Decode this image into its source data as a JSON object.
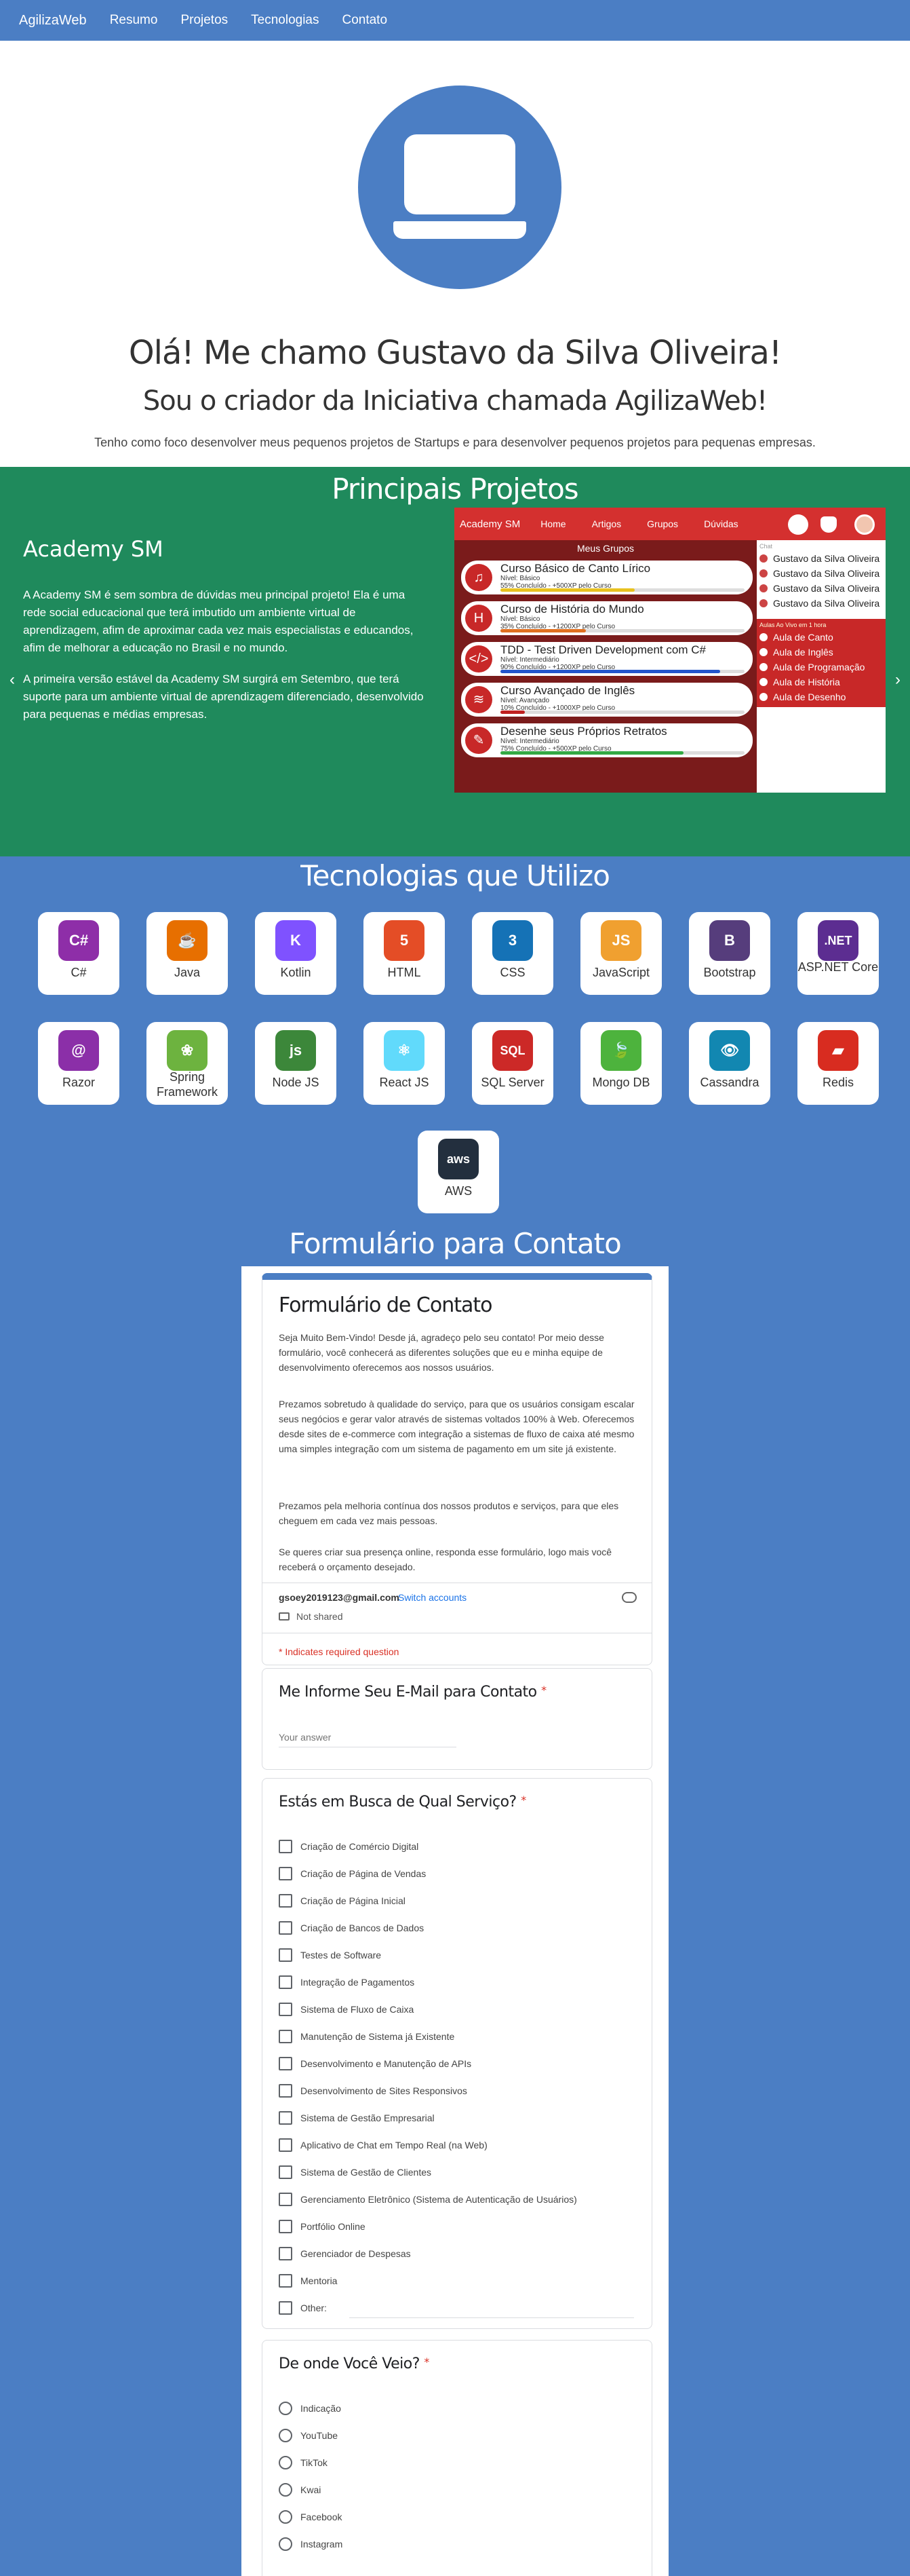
{
  "nav": {
    "brand": "AgilizaWeb",
    "links": [
      "Resumo",
      "Projetos",
      "Tecnologias",
      "Contato"
    ]
  },
  "hero": {
    "title": "Olá! Me chamo Gustavo da Silva Oliveira!",
    "subtitle": "Sou o criador da Iniciativa chamada AgilizaWeb!",
    "tagline": "Tenho como foco desenvolver meus pequenos projetos de Startups e para desenvolver pequenos projetos para pequenas empresas.",
    "avatar_icon": "laptop-icon"
  },
  "projects": {
    "heading": "Principais Projetos",
    "project_title": "Academy SM",
    "desc1": "A Academy SM é sem sombra de dúvidas meu principal projeto! Ela é uma rede social educacional que terá imbutido um ambiente virtual de aprendizagem, afim de aproximar cada vez mais especialistas e educandos, afim de melhorar a educação no Brasil e no mundo.",
    "desc2": "A primeira versão estável da Academy SM surgirá em Setembro, que terá suporte para um ambiente virtual de aprendizagem diferenciado, desenvolvido para pequenas e médias empresas.",
    "prev": "‹",
    "next": "›",
    "mock": {
      "brand": "Academy SM",
      "menu": [
        "Home",
        "Artigos",
        "Grupos",
        "Dúvidas"
      ],
      "groups_title": "Meus Grupos",
      "courses": [
        {
          "title": "Curso Básico de Canto Lírico",
          "level": "Nível: Básico",
          "progress_text": "55% Concluído - +500XP pelo Curso",
          "progress": 0.55,
          "color": "#e8c220",
          "icon": "♫"
        },
        {
          "title": "Curso de História do Mundo",
          "level": "Nível: Básico",
          "progress_text": "35% Concluído - +1200XP pelo Curso",
          "progress": 0.35,
          "color": "#e07020",
          "icon": "H"
        },
        {
          "title": "TDD - Test Driven Development com C#",
          "level": "Nível: Intermediário",
          "progress_text": "90% Concluído - +1200XP pelo Curso",
          "progress": 0.9,
          "color": "#2255cc",
          "icon": "</>"
        },
        {
          "title": "Curso Avançado de Inglês",
          "level": "Nível: Avançado",
          "progress_text": "10% Concluído - +1000XP pelo Curso",
          "progress": 0.1,
          "color": "#c02020",
          "icon": "≋"
        },
        {
          "title": "Desenhe seus Próprios Retratos",
          "level": "Nível: Intermediário",
          "progress_text": "75% Concluído - +500XP pelo Curso",
          "progress": 0.75,
          "color": "#33aa44",
          "icon": "✎"
        }
      ],
      "online_label": "Chat",
      "users": [
        "Gustavo da Silva Oliveira",
        "Gustavo da Silva Oliveira",
        "Gustavo da Silva Oliveira",
        "Gustavo da Silva Oliveira"
      ],
      "upcoming_label": "Aulas Ao Vivo em 1 hora",
      "classes": [
        "Aula de Canto",
        "Aula de Inglês",
        "Aula de Programação",
        "Aula de História",
        "Aula de Desenho"
      ]
    }
  },
  "tech": {
    "heading": "Tecnologias que Utilizo",
    "items": [
      {
        "label": "C#",
        "icon": "csharp-icon",
        "color": "#8e2ea8",
        "glyph": "C#"
      },
      {
        "label": "Java",
        "icon": "java-icon",
        "color": "#e76f00",
        "glyph": "☕"
      },
      {
        "label": "Kotlin",
        "icon": "kotlin-icon",
        "color": "#7f52ff",
        "glyph": "K"
      },
      {
        "label": "HTML",
        "icon": "html5-icon",
        "color": "#e44d26",
        "glyph": "5"
      },
      {
        "label": "CSS",
        "icon": "css3-icon",
        "color": "#1572b6",
        "glyph": "3"
      },
      {
        "label": "JavaScript",
        "icon": "js-icon",
        "color": "#f0a030",
        "glyph": "JS"
      },
      {
        "label": "Bootstrap",
        "icon": "bootstrap-icon",
        "color": "#563d7c",
        "glyph": "B"
      },
      {
        "label": "ASP.NET Core",
        "icon": "dotnet-icon",
        "color": "#5c2d91",
        "glyph": ".NET"
      },
      {
        "label": "Razor",
        "icon": "razor-icon",
        "color": "#8b2fa8",
        "glyph": "@"
      },
      {
        "label": "Spring Framework",
        "icon": "spring-icon",
        "color": "#6db33f",
        "glyph": "❀"
      },
      {
        "label": "Node JS",
        "icon": "nodejs-icon",
        "color": "#3c873a",
        "glyph": "js"
      },
      {
        "label": "React JS",
        "icon": "react-icon",
        "color": "#61dafb",
        "glyph": "⚛"
      },
      {
        "label": "SQL Server",
        "icon": "sqlserver-icon",
        "color": "#cc2927",
        "glyph": "SQL"
      },
      {
        "label": "Mongo DB",
        "icon": "mongodb-icon",
        "color": "#4db33d",
        "glyph": "🍃"
      },
      {
        "label": "Cassandra",
        "icon": "cassandra-icon",
        "color": "#1287b1",
        "glyph": "👁"
      },
      {
        "label": "Redis",
        "icon": "redis-icon",
        "color": "#d82c20",
        "glyph": "▰"
      },
      {
        "label": "AWS",
        "icon": "aws-icon",
        "color": "#232f3e",
        "glyph": "aws"
      }
    ]
  },
  "form": {
    "heading": "Formulário para Contato",
    "title": "Formulário de Contato",
    "p1": "Seja Muito Bem-Vindo! Desde já, agradeço pelo seu contato! Por meio desse formulário, você conhecerá as diferentes soluções que eu e minha equipe de desenvolvimento oferecemos aos nossos usuários.",
    "p2": "Prezamos sobretudo à qualidade do serviço, para que os usuários consigam escalar seus negócios e gerar valor através de sistemas voltados 100% à Web. Oferecemos desde sites de e-commerce com integração a sistemas de fluxo de caixa até mesmo uma simples integração com um sistema de pagamento em um site já existente.",
    "p3": "Prezamos pela melhoria contínua dos nossos produtos e serviços, para que eles cheguem em cada vez mais pessoas.",
    "p4": "Se queres criar sua presença online, responda esse formulário, logo mais você receberá o orçamento desejado.",
    "email": "gsoey2019123@gmail.com",
    "switch": "Switch accounts",
    "not_shared": "Not shared",
    "required": "* Indicates required question",
    "q1": "Me Informe Seu E-Mail para Contato",
    "q1_placeholder": "Your answer",
    "q2": "Estás em Busca de Qual Serviço?",
    "q2_options": [
      "Criação de Comércio Digital",
      "Criação de Página de Vendas",
      "Criação de Página Inicial",
      "Criação de Bancos de Dados",
      "Testes de Software",
      "Integração de Pagamentos",
      "Sistema de Fluxo de Caixa",
      "Manutenção de Sistema já Existente",
      "Desenvolvimento e Manutenção de APIs",
      "Desenvolvimento de Sites Responsivos",
      "Sistema de Gestão Empresarial",
      "Aplicativo de Chat em Tempo Real (na Web)",
      "Sistema de Gestão de Clientes",
      "Gerenciamento Eletrônico (Sistema de Autenticação de Usuários)",
      "Portfólio Online",
      "Gerenciador de Despesas",
      "Mentoria",
      "Other:"
    ],
    "q3": "De onde Você Veio?",
    "q3_options": [
      "Indicação",
      "YouTube",
      "TikTok",
      "Kwai",
      "Facebook",
      "Instagram"
    ],
    "star": "*"
  }
}
